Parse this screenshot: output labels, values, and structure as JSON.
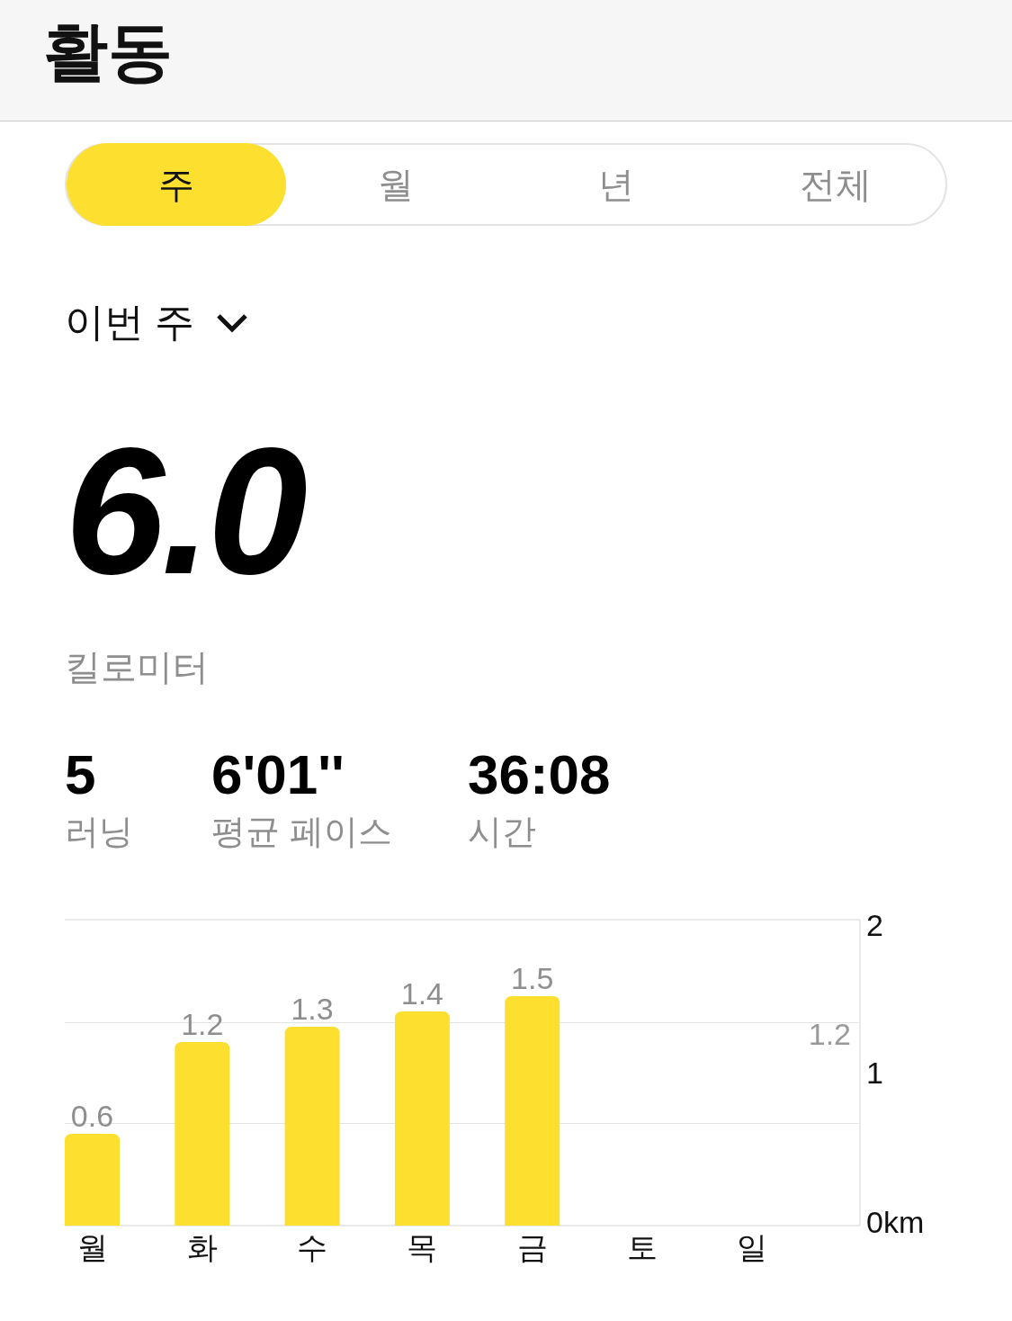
{
  "header": {
    "title": "활동"
  },
  "tabs": [
    {
      "label": "주",
      "selected": true
    },
    {
      "label": "월",
      "selected": false
    },
    {
      "label": "년",
      "selected": false
    },
    {
      "label": "전체",
      "selected": false
    }
  ],
  "period": {
    "label": "이번 주"
  },
  "summary": {
    "value": "6.0",
    "unit": "킬로미터"
  },
  "stats": [
    {
      "value": "5",
      "label": "러닝"
    },
    {
      "value": "6'01''",
      "label": "평균 페이스"
    },
    {
      "value": "36:08",
      "label": "시간"
    }
  ],
  "chart": {
    "chart_data": {
      "type": "bar",
      "categories": [
        "월",
        "화",
        "수",
        "목",
        "금",
        "토",
        "일"
      ],
      "values": [
        0.6,
        1.2,
        1.3,
        1.4,
        1.5,
        null,
        null
      ],
      "value_labels": [
        "0.6",
        "1.2",
        "1.3",
        "1.4",
        "1.5",
        null,
        null
      ],
      "ylim": [
        0,
        2
      ],
      "yticks": [
        {
          "value": 0,
          "label": "0km"
        },
        {
          "value": 1,
          "label": "1"
        },
        {
          "value": 2,
          "label": "2"
        }
      ],
      "annotations": [
        "1.2"
      ]
    }
  }
}
